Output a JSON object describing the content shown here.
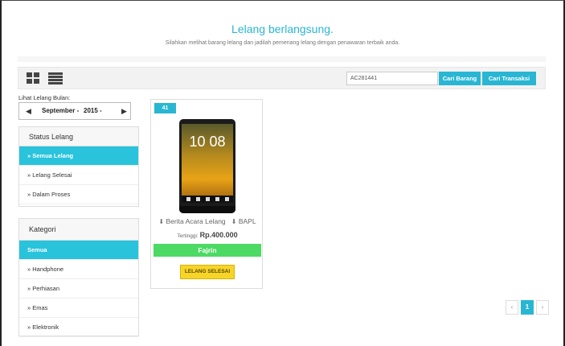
{
  "header": {
    "title": "Lelang berlangsung.",
    "subtitle": "Silahkan melihat barang lelang dan jadilah pemenang lelang dengan penawaran terbaik anda."
  },
  "toolbar": {
    "search_value": "AC281441",
    "cari_barang_label": "Cari Barang",
    "cari_transaksi_label": "Cari Transaksi"
  },
  "month_filter": {
    "label": "Lihat Lelang Bulan:",
    "month": "September -",
    "year": "2015 -"
  },
  "status_panel": {
    "title": "Status Lelang",
    "items": [
      {
        "label": "»  Semua Lelang"
      },
      {
        "label": "»  Lelang Selesai"
      },
      {
        "label": "»  Dalam Proses"
      }
    ]
  },
  "kategori_panel": {
    "title": "Kategori",
    "items": [
      {
        "label": "Semua"
      },
      {
        "label": "»  Handphone"
      },
      {
        "label": "»  Perhiasan"
      },
      {
        "label": "»  Emas"
      },
      {
        "label": "»  Elektronik"
      }
    ]
  },
  "card": {
    "badge": "41",
    "phone_clock": "10 08",
    "berita_label": "Berita Acara Lelang",
    "bapl_label": "BAPL",
    "tertinggi_label": "Tertinggi:",
    "tertinggi_value": "Rp.400.000",
    "winner": "Fajrin",
    "status_button": "LELANG SELESAI"
  },
  "pagination": {
    "prev": "‹",
    "current": "1",
    "next": "›"
  },
  "colors": {
    "accent": "#29b6d3",
    "winner": "#4cd964",
    "button_yellow": "#f7d428"
  }
}
